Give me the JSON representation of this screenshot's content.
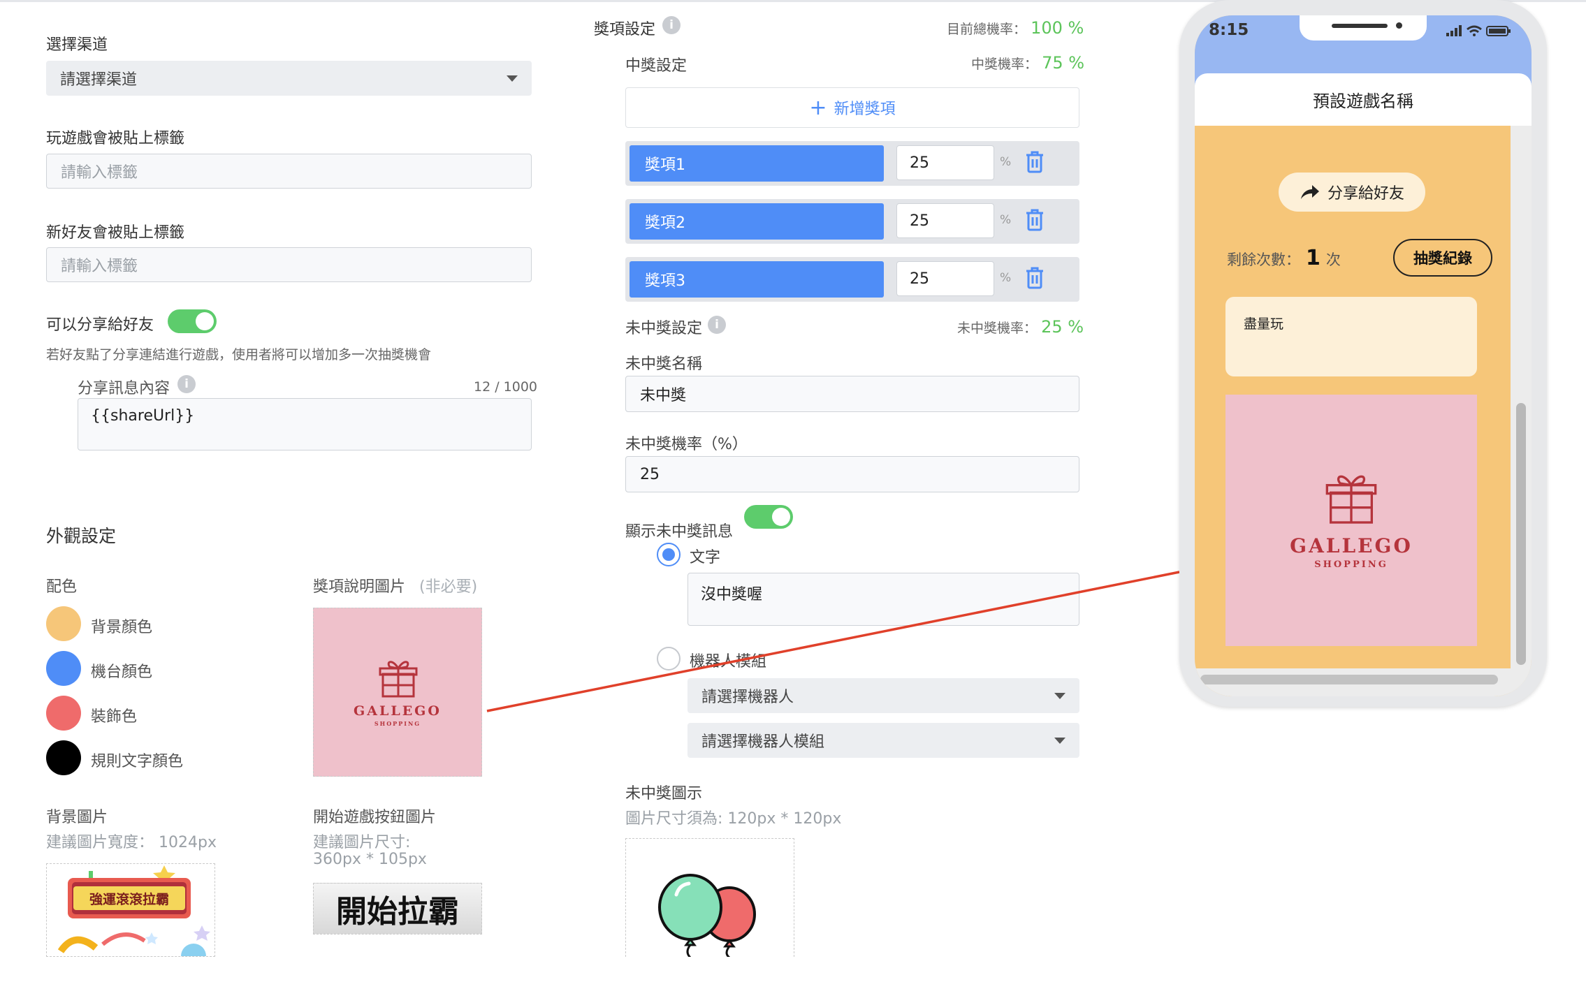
{
  "left": {
    "channel": {
      "label": "選擇渠道",
      "placeholder": "請選擇渠道"
    },
    "play_tag": {
      "label": "玩遊戲會被貼上標籤",
      "placeholder": "請輸入標籤"
    },
    "new_friend_tag": {
      "label": "新好友會被貼上標籤",
      "placeholder": "請輸入標籤"
    },
    "share": {
      "label": "可以分享給好友",
      "enabled": true,
      "hint": "若好友點了分享連結進行遊戲，使用者將可以增加多一次抽獎機會",
      "message_label": "分享訊息內容",
      "message_count": "12 / 1000",
      "message_value": "{{shareUrl}}"
    },
    "appearance": {
      "title": "外觀設定",
      "color_section": "配色",
      "colors": [
        {
          "label": "背景顏色",
          "hex": "#f6c679"
        },
        {
          "label": "機台顏色",
          "hex": "#4f8df7"
        },
        {
          "label": "裝飾色",
          "hex": "#ef6b6b"
        },
        {
          "label": "規則文字顏色",
          "hex": "#000000"
        }
      ],
      "prize_image_label": "獎項說明圖片",
      "prize_image_optional": "(非必要)",
      "bg_image_label": "背景圖片",
      "bg_image_hint": "建議圖片寬度： 1024px",
      "start_button_label": "開始遊戲按鈕圖片",
      "start_button_hint_1": "建議圖片尺寸:",
      "start_button_hint_2": "360px * 105px",
      "bg_image_banner_text": "強運滾滾拉霸",
      "start_button_text": "開始拉霸"
    }
  },
  "prizes": {
    "title": "獎項設定",
    "total_rate_label": "目前總機率：",
    "total_rate_value": "100 %",
    "win_section": "中獎設定",
    "win_rate_label": "中獎機率：",
    "win_rate_value": "75 %",
    "add_button": "新增獎項",
    "items": [
      {
        "name": "獎項1",
        "rate": "25",
        "unit": "%"
      },
      {
        "name": "獎項2",
        "rate": "25",
        "unit": "%"
      },
      {
        "name": "獎項3",
        "rate": "25",
        "unit": "%"
      }
    ],
    "lose_section": "未中獎設定",
    "lose_rate_label": "未中獎機率：",
    "lose_rate_value": "25 %",
    "lose_name_label": "未中獎名稱",
    "lose_name_value": "未中獎",
    "lose_prob_label": "未中獎機率（%）",
    "lose_prob_value": "25",
    "show_message_label": "顯示未中獎訊息",
    "show_message_enabled": true,
    "option_text_label": "文字",
    "option_text_value": "沒中獎喔",
    "option_bot_label": "機器人模組",
    "bot_select_placeholder": "請選擇機器人",
    "bot_module_placeholder": "請選擇機器人模組",
    "lose_icon_label": "未中獎圖示",
    "lose_icon_hint": "圖片尺寸須為: 120px * 120px"
  },
  "phone": {
    "time": "8:15",
    "game_title": "預設遊戲名稱",
    "share_button": "分享給好友",
    "remaining_label": "剩餘次數：",
    "remaining_count": "1",
    "remaining_unit": "次",
    "history_button": "抽獎紀錄",
    "message_text": "盡量玩",
    "brand": "GALLEGO",
    "brand_sub": "SHOPPING"
  },
  "colors": {
    "accent_blue": "#4f8df7",
    "green": "#5cc45a",
    "game_bg": "#f6c679",
    "arrow": "#e0402a"
  }
}
